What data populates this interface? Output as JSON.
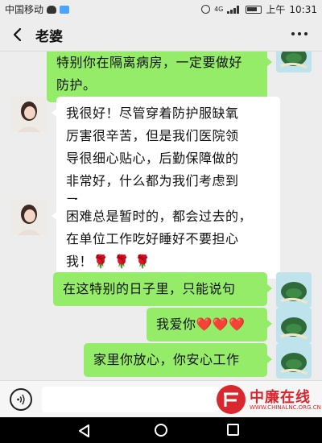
{
  "status_bar": {
    "carrier": "中国移动",
    "network": "4G",
    "am_pm": "上午",
    "time": "10:31"
  },
  "header": {
    "title": "老婆"
  },
  "messages": [
    {
      "from": "me",
      "text_lines": [
        "特别你在隔离病房，一定要做好",
        "防护。"
      ]
    },
    {
      "from": "her",
      "text_lines": [
        "我很好！尽管穿着防护服缺氧",
        "厉害很辛苦，但是我们医院领",
        "导很细心贴心，后勤保障做的",
        "非常好，什么都为我们考虑到",
        "了。"
      ]
    },
    {
      "from": "her",
      "text_lines": [
        "困难总是暂时的，都会过去的，",
        "在单位工作吃好睡好不要担心",
        "我！🌹 🌹 🌹"
      ]
    },
    {
      "from": "me",
      "text": "在这特别的日子里，只能说句"
    },
    {
      "from": "me",
      "text": "我爱你❤️❤️❤️"
    },
    {
      "from": "me",
      "text": "家里你放心，你安心工作"
    }
  ],
  "watermark": {
    "name": "中廉在线",
    "url": "WWW.CHINALNC.ORG.CN"
  },
  "colors": {
    "sent_bubble": "#95ec69",
    "received_bubble": "#ffffff",
    "background": "#ededed",
    "watermark": "#d8272d"
  },
  "icons": {
    "back": "chevron-left-icon",
    "more": "more-dots-icon",
    "voice": "voice-icon"
  }
}
